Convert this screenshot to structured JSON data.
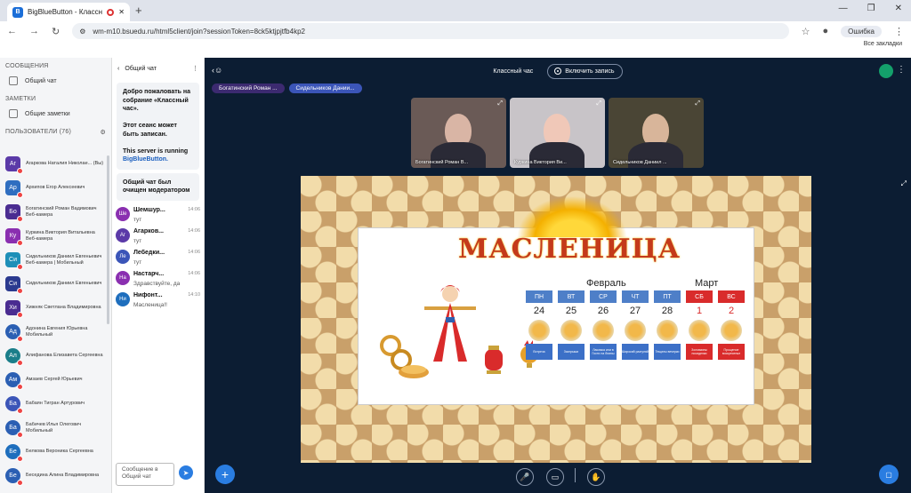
{
  "browser": {
    "tab_title": "BigBlueButton - Классный",
    "url": "wm-m10.bsuedu.ru/html5client/join?sessionToken=8ck5ktjpjtfb4kp2",
    "error_label": "Ошибка",
    "bookmarks_label": "Все закладки"
  },
  "sidebar": {
    "messages_header": "СООБЩЕНИЯ",
    "public_chat": "Общий чат",
    "notes_header": "ЗАМЕТКИ",
    "shared_notes": "Общие заметки",
    "users_header": "ПОЛЬЗОВАТЕЛИ (76)",
    "users": [
      {
        "initials": "Аг",
        "name": "Агаркова Наталия Николае... (Вы)",
        "color": "#5b3aa8",
        "round": false
      },
      {
        "initials": "Ар",
        "name": "Архипов Егор Алексеевич",
        "color": "#2f6ec0",
        "round": false
      },
      {
        "initials": "Бо",
        "name": "Богатинский Роман Вадимович",
        "sub": "Веб-камера",
        "color": "#4a2c91",
        "round": false
      },
      {
        "initials": "Ку",
        "name": "Куркина Виктория Витальевна",
        "sub": "Веб-камера",
        "color": "#8a2fb0",
        "round": false
      },
      {
        "initials": "Си",
        "name": "Сидельников Даниил Евгеньевич",
        "sub": "Веб-камера | Мобильный",
        "color": "#1e8fb8",
        "round": false
      },
      {
        "initials": "Си",
        "name": "Сидельников Даниил Евгеньевич",
        "color": "#2b3a8f",
        "round": false
      },
      {
        "initials": "Хи",
        "name": "Хижняк Светлана Владимировна",
        "color": "#4a2c91",
        "round": false
      },
      {
        "initials": "Ад",
        "name": "Адонина Евгения Юрьевна",
        "sub": "Мобильный",
        "color": "#2b5fb3",
        "round": true
      },
      {
        "initials": "Ал",
        "name": "Алифанова Елизавета Сергеевна",
        "color": "#1a7e8a",
        "round": true
      },
      {
        "initials": "Ам",
        "name": "Амзаев Сергей Юрьевич",
        "color": "#2b5fb3",
        "round": true
      },
      {
        "initials": "Ба",
        "name": "Бабаян Тигран Артурович",
        "color": "#3b55b8",
        "round": true
      },
      {
        "initials": "Ба",
        "name": "Бабичев Илья Олегович",
        "sub": "Мобильный",
        "color": "#2b5fb3",
        "round": true
      },
      {
        "initials": "Бе",
        "name": "Белкова Вероника Сергеевна",
        "color": "#1e6ebd",
        "round": true
      },
      {
        "initials": "Бе",
        "name": "Беседина Алина Владимировна",
        "color": "#2b5fb3",
        "round": true
      }
    ]
  },
  "chat": {
    "title": "Общий чат",
    "welcome_1": "Добро пожаловать на собрание «Классный час».",
    "welcome_2": "Этот сеанс может быть записан.",
    "welcome_3": "This server is running",
    "welcome_link": "BigBlueButton.",
    "cleared": "Общий чат был очищен модератором",
    "messages": [
      {
        "initials": "Ше",
        "name": "Шемшур...",
        "time": "14:06",
        "text": "тут",
        "color": "#8a2fb0"
      },
      {
        "initials": "Аг",
        "name": "Агарков...",
        "time": "14:06",
        "text": "тут",
        "color": "#5b3aa8"
      },
      {
        "initials": "Ле",
        "name": "Лебедки...",
        "time": "14:06",
        "text": "тут",
        "color": "#3b55b8"
      },
      {
        "initials": "На",
        "name": "Настарч...",
        "time": "14:06",
        "text": "Здравствуйте, да",
        "color": "#8a2fb0"
      },
      {
        "initials": "Ни",
        "name": "Нифонт...",
        "time": "14:10",
        "text": "Масленица!!",
        "color": "#1e6ebd"
      }
    ],
    "input_placeholder": "Сообщение в Общий чат"
  },
  "main": {
    "meeting_title": "Классный час",
    "record_label": "Включить запись",
    "talkers": [
      {
        "name": "Богатинский Роман ...",
        "color": "#3c2a70"
      },
      {
        "name": "Сидельников Дании...",
        "color": "#3b55b8"
      }
    ],
    "videos": [
      {
        "name": "Богатинский Роман В...",
        "bg": "#6a5a56",
        "face": "#d9b5a5"
      },
      {
        "name": "Куркина Виктория Ви...",
        "bg": "#c8c4c8",
        "face": "#f0c8b8"
      },
      {
        "name": "Сидельников Даниил ...",
        "bg": "#4a4535",
        "face": "#d8b59a"
      }
    ]
  },
  "slide": {
    "title": "МАСЛЕНИЦА",
    "month_feb": "Февраль",
    "month_mar": "Март",
    "days": [
      {
        "d": "ПН",
        "n": "24",
        "l": "Встреча",
        "w": false
      },
      {
        "d": "ВТ",
        "n": "25",
        "l": "Заигрыши",
        "w": false
      },
      {
        "d": "СР",
        "n": "26",
        "l": "Лакомка или в Гости на блины",
        "w": false
      },
      {
        "d": "ЧТ",
        "n": "27",
        "l": "Широкий разгуляй",
        "w": false
      },
      {
        "d": "ПТ",
        "n": "28",
        "l": "Тещины вечерки",
        "w": false
      },
      {
        "d": "СБ",
        "n": "1",
        "l": "Золовкины посиделки",
        "w": true
      },
      {
        "d": "ВС",
        "n": "2",
        "l": "Прощеное воскресенье",
        "w": true
      }
    ]
  }
}
